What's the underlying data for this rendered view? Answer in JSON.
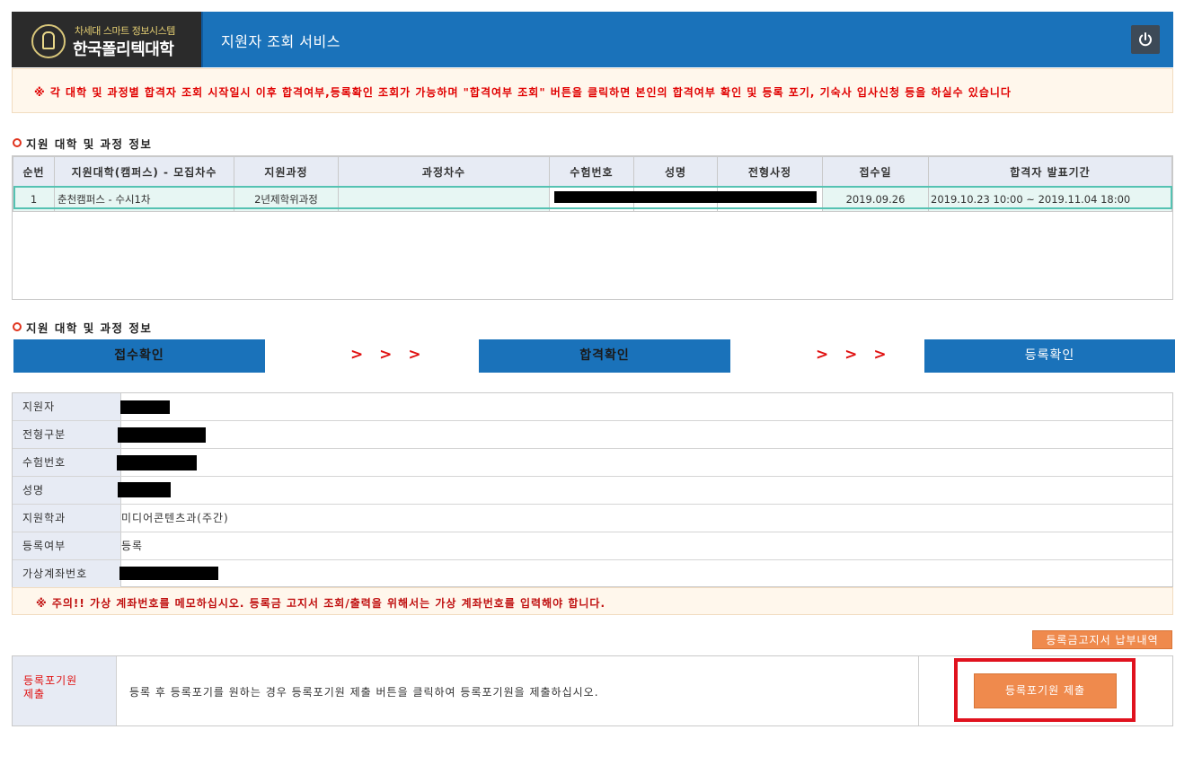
{
  "header": {
    "logo_sub": "차세대 스마트 정보시스템",
    "logo_main": "한국폴리텍대학",
    "service_title": "지원자 조회 서비스",
    "power_icon": "power-icon"
  },
  "notice": "※ 각 대학 및 과정별 합격자 조회 시작일시 이후 합격여부,등록확인 조회가 가능하며 \"합격여부 조회\" 버튼을 클릭하면 본인의 합격여부 확인 및 등록 포기, 기숙사 입사신청 등을 하실수 있습니다",
  "section1_title": "지원 대학 및 과정 정보",
  "table": {
    "headers": [
      "순번",
      "지원대학(캠퍼스) - 모집차수",
      "지원과정",
      "과정차수",
      "수험번호",
      "성명",
      "전형사정",
      "접수일",
      "합격자 발표기간"
    ],
    "rows": [
      {
        "no": "1",
        "campus": "춘천캠퍼스 - 수시1차",
        "course": "2년제학위과정",
        "round": "",
        "exam_no": "",
        "name": "",
        "screening": "",
        "date": "2019.09.26",
        "announce": "2019.10.23 10:00 ~ 2019.11.04 18:00"
      }
    ]
  },
  "section2_title": "지원 대학 및 과정 정보",
  "steps": {
    "step1": "접수확인",
    "step2": "합격확인",
    "step3": "등록확인",
    "arrows": "> > >"
  },
  "info": [
    {
      "label": "지원자",
      "value": ""
    },
    {
      "label": "전형구분",
      "value": ""
    },
    {
      "label": "수험번호",
      "value": ""
    },
    {
      "label": "성명",
      "value": ""
    },
    {
      "label": "지원학과",
      "value": "미디어콘텐츠과(주간)"
    },
    {
      "label": "등록여부",
      "value": "등록"
    },
    {
      "label": "가상계좌번호",
      "value": ""
    }
  ],
  "warning": "※ 주의!! 가상 계좌번호를 메모하십시오. 등록금 고지서 조회/출력을 위해서는 가상 계좌번호를 입력해야 합니다.",
  "invoice_button": "등록금고지서 납부내역",
  "giveup": {
    "label_line1": "등록포기원",
    "label_line2": "제출",
    "description": "등록 후 등록포기를 원하는 경우 등록포기원 제출 버튼을 클릭하여 등록포기원을 제출하십시오.",
    "button": "등록포기원 제출"
  },
  "colors": {
    "header_blue": "#1a72ba",
    "notice_red": "#e00000",
    "button_orange": "#ef8a4d",
    "highlight_red": "#e0121e"
  }
}
